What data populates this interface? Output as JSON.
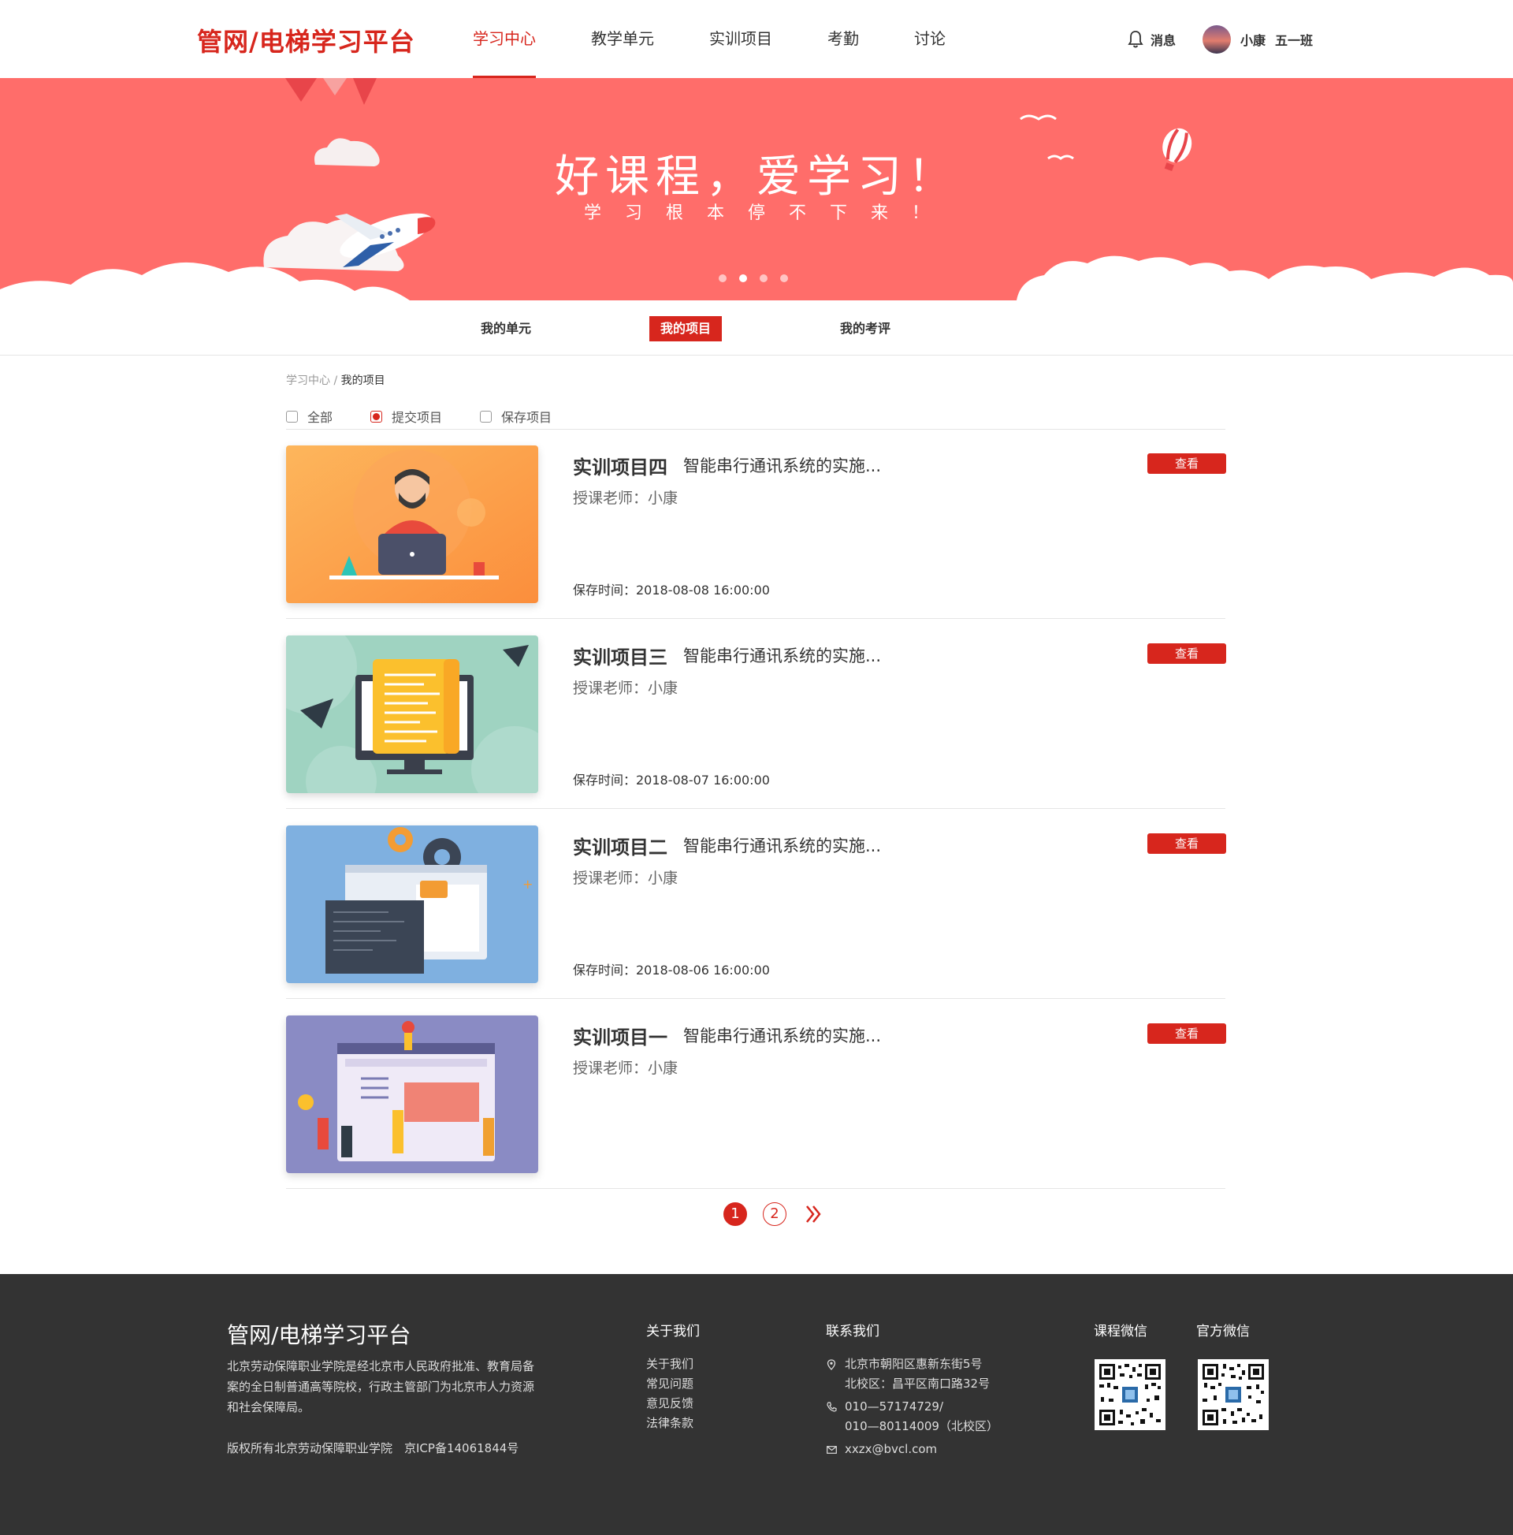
{
  "header": {
    "logo": "管网/电梯学习平台",
    "nav": [
      "学习中心",
      "教学单元",
      "实训项目",
      "考勤",
      "讨论"
    ],
    "messages_label": "消息",
    "user_name": "小康",
    "user_class": "五一班"
  },
  "banner": {
    "title": "好课程，爱学习！",
    "subtitle": "学习根本停不下来！",
    "slide_count": 4,
    "active_slide": 2
  },
  "subtabs": [
    "我的单元",
    "我的项目",
    "我的考评"
  ],
  "breadcrumb": {
    "parent": "学习中心",
    "separator": " / ",
    "current": "我的项目"
  },
  "filters": [
    {
      "label": "全部",
      "checked": false
    },
    {
      "label": "提交项目",
      "checked": true
    },
    {
      "label": "保存项目",
      "checked": false
    }
  ],
  "projects": [
    {
      "title": "实训项目四",
      "desc": "智能串行通讯系统的实施...",
      "teacher": "授课老师：小康",
      "time": "保存时间：2018-08-08 16:00:00",
      "button": "查看"
    },
    {
      "title": "实训项目三",
      "desc": "智能串行通讯系统的实施...",
      "teacher": "授课老师：小康",
      "time": "保存时间：2018-08-07 16:00:00",
      "button": "查看"
    },
    {
      "title": "实训项目二",
      "desc": "智能串行通讯系统的实施...",
      "teacher": "授课老师：小康",
      "time": "保存时间：2018-08-06 16:00:00",
      "button": "查看"
    },
    {
      "title": "实训项目一",
      "desc": "智能串行通讯系统的实施...",
      "teacher": "授课老师：小康",
      "time": "",
      "button": "查看"
    }
  ],
  "pagination": {
    "pages": [
      "1",
      "2"
    ],
    "current": "1"
  },
  "footer": {
    "brand": "管网/电梯学习平台",
    "intro": "北京劳动保障职业学院是经北京市人民政府批准、教育局备案的全日制普通高等院校，行政主管部门为北京市人力资源和社会保障局。",
    "copyright": "版权所有北京劳动保障职业学院　京ICP备14061844号",
    "about_title": "关于我们",
    "about_links": [
      "关于我们",
      "常见问题",
      "意见反馈",
      "法律条款"
    ],
    "contact_title": "联系我们",
    "address_1": "北京市朝阳区惠新东街5号",
    "address_2": "北校区：昌平区南口路32号",
    "phone_1": "010—57174729/",
    "phone_2": "010—80114009（北校区）",
    "email": "xxzx@bvcl.com",
    "qr_course_title": "课程微信",
    "qr_official_title": "官方微信"
  },
  "colors": {
    "brand_red": "#d7261d",
    "banner_bg": "#ff6d6a",
    "footer_bg": "#333333"
  }
}
